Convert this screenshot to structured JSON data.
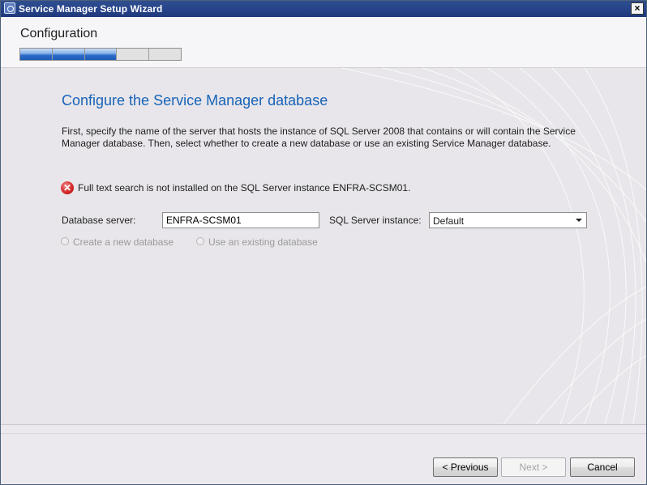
{
  "window": {
    "title": "Service Manager Setup Wizard",
    "close_glyph": "×"
  },
  "header": {
    "stage_title": "Configuration",
    "progress": {
      "completed_steps": 3,
      "total_steps": 5
    }
  },
  "main": {
    "heading": "Configure the Service Manager database",
    "description": "First, specify the name of the server that hosts the instance of SQL Server 2008 that contains or will contain the Service Manager database. Then, select whether to create a new database or use an existing Service Manager database.",
    "error": {
      "icon": "error-x-icon",
      "message": "Full text search is not installed on the SQL Server instance ENFRA-SCSM01."
    },
    "database_server": {
      "label": "Database server:",
      "value": "ENFRA-SCSM01"
    },
    "sql_instance": {
      "label": "SQL Server instance:",
      "selected": "Default"
    },
    "options": [
      {
        "label": "Create a new database",
        "enabled": false,
        "selected": false
      },
      {
        "label": "Use an existing database",
        "enabled": false,
        "selected": false
      }
    ]
  },
  "footer": {
    "previous_label": "< Previous",
    "next_label": "Next >",
    "cancel_label": "Cancel"
  },
  "colors": {
    "titlebar": "#27448a",
    "heading": "#1763b8",
    "progress_fill": "#2b6cc8",
    "error": "#d42a2a"
  }
}
